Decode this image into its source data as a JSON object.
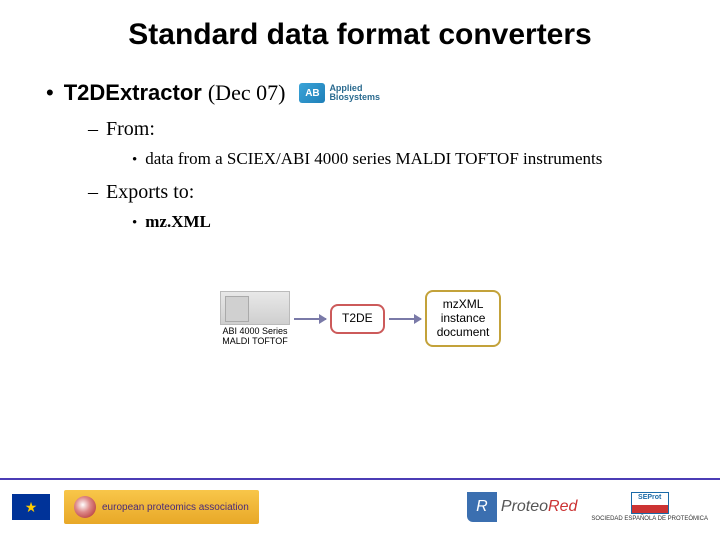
{
  "title": "Standard data format converters",
  "item": {
    "name": "T2DExtractor",
    "date": "(Dec 07)",
    "vendor": {
      "mark": "AB",
      "line1": "Applied",
      "line2": "Biosystems"
    }
  },
  "from": {
    "heading": "From:",
    "detail": "data from a SCIEX/ABI 4000 series MALDI TOFTOF instruments"
  },
  "exports": {
    "heading": "Exports to:",
    "detail": "mz.XML"
  },
  "diagram": {
    "instrument_l1": "ABI 4000 Series",
    "instrument_l2": "MALDI TOFTOF",
    "middle": "T2DE",
    "out_l1": "mzXML",
    "out_l2": "instance",
    "out_l3": "document"
  },
  "footer": {
    "eu": "★",
    "eupa": "european proteomics association",
    "proteored_gray": "Proteo",
    "proteored_red": "Red",
    "sep_mark": "SEProt",
    "sep_label": "SOCIEDAD ESPAÑOLA DE PROTEÓMICA"
  }
}
